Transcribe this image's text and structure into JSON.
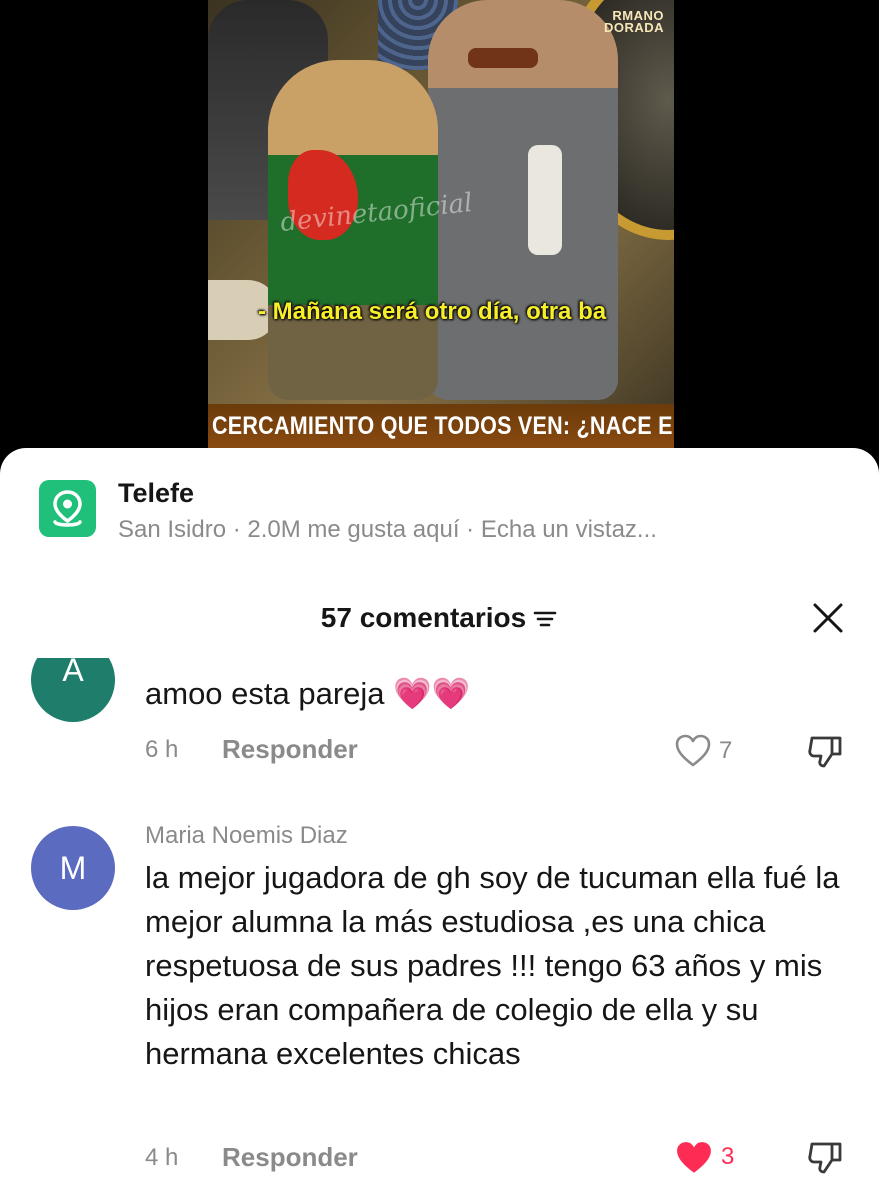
{
  "video": {
    "brand_text": "RMANO\nDORADA",
    "watermark": "devinetaoficial",
    "subtitle": "- Mañana será otro día, otra ba",
    "banner": "CERCAMIENTO QUE TODOS VEN: ¿NACE E"
  },
  "place": {
    "name": "Telefe",
    "meta": "San Isidro · 2.0M me gusta aquí · Echa un vistaz...",
    "icon": "map-pin-icon",
    "accent": "#20C07A"
  },
  "comments_header": {
    "title": "57 comentarios",
    "sort_icon": "sort-icon",
    "close_icon": "close-icon"
  },
  "comments": [
    {
      "avatar_letter": "A",
      "avatar_color": "#1E7E6B",
      "text": "amoo esta pareja 💗💗",
      "time": "6 h",
      "reply_label": "Responder",
      "likes": "7",
      "liked": false
    },
    {
      "avatar_letter": "M",
      "avatar_color": "#5B6BC0",
      "username": "Maria Noemis Diaz",
      "text": "la mejor jugadora de gh soy de tucuman ella fué la mejor alumna la más estudiosa ,es una chica respetuosa de sus padres !!! tengo 63 años y mis hijos eran compañera de colegio de ella y su hermana excelentes chicas",
      "time": "4 h",
      "reply_label": "Responder",
      "likes": "3",
      "liked": true
    }
  ],
  "colors": {
    "like_active": "#FE2C55",
    "text_secondary": "#8A8A8A"
  }
}
